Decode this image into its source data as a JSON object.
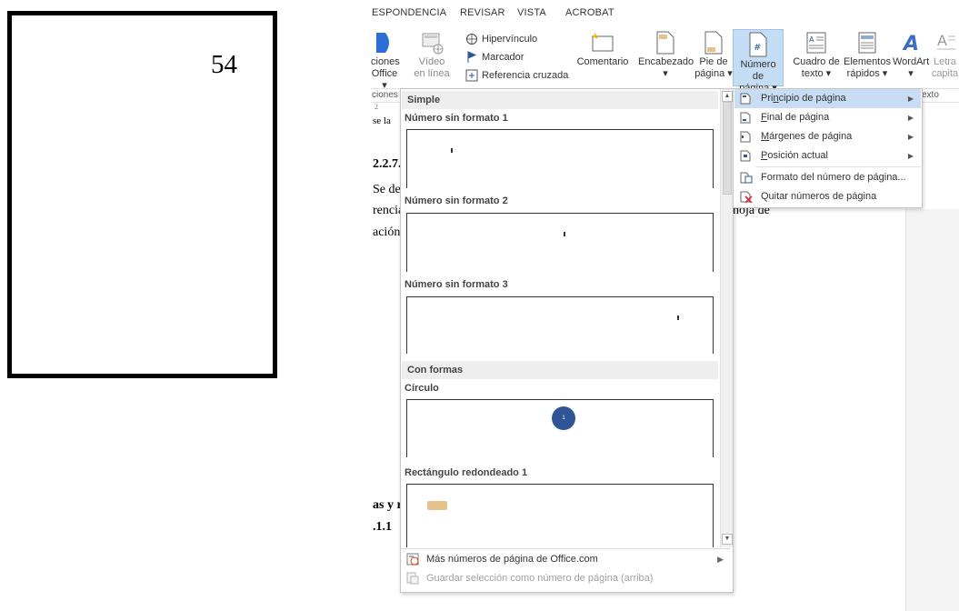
{
  "left_box": {
    "number": "54"
  },
  "tabs": [
    "ESPONDENCIA",
    "REVISAR",
    "VISTA",
    "ACROBAT"
  ],
  "ribbon": {
    "apps_label": [
      "ciones",
      "Office ▾"
    ],
    "video_label": [
      "Vídeo",
      "en línea"
    ],
    "hyperlink": "Hipervínculo",
    "bookmark": "Marcador",
    "crossref": "Referencia cruzada",
    "comment": "Comentario",
    "header": [
      "Encabezado",
      "▾"
    ],
    "footer": [
      "Pie de",
      "página ▾"
    ],
    "page_number": [
      "Número de",
      "página ▾"
    ],
    "textbox": [
      "Cuadro de",
      "texto ▾"
    ],
    "quickparts": [
      "Elementos",
      "rápidos ▾"
    ],
    "wordart": [
      "WordArt",
      "▾"
    ],
    "dropcap": [
      "Letra",
      "capita"
    ],
    "group_left": "ciones",
    "group_right": "exto"
  },
  "document": {
    "ruler": "2",
    "lines": [
      "se la",
      "2.2.7.",
      "Se de",
      "rencia",
      "ación",
      "hoja de",
      "as y r",
      ".1.1"
    ]
  },
  "gallery": {
    "sections": [
      "Simple",
      "Con formas"
    ],
    "items": [
      "Número sin formato 1",
      "Número sin formato 2",
      "Número sin formato 3",
      "Círculo",
      "Rectángulo redondeado 1"
    ],
    "circle_number": "1",
    "footer": {
      "more": "Más números de página de Office.com",
      "save": "Guardar selección como número de página (arriba)"
    }
  },
  "submenu": {
    "items": [
      "Principio de página",
      "Final de página",
      "Márgenes de página",
      "Posición actual",
      "Formato del número de página...",
      "Quitar números de página"
    ]
  },
  "colors": {
    "accent_blue": "#2b579a",
    "circle_fill": "#2f5597",
    "rect_fill": "#e5c18b",
    "highlight": "#c8ddf4"
  }
}
